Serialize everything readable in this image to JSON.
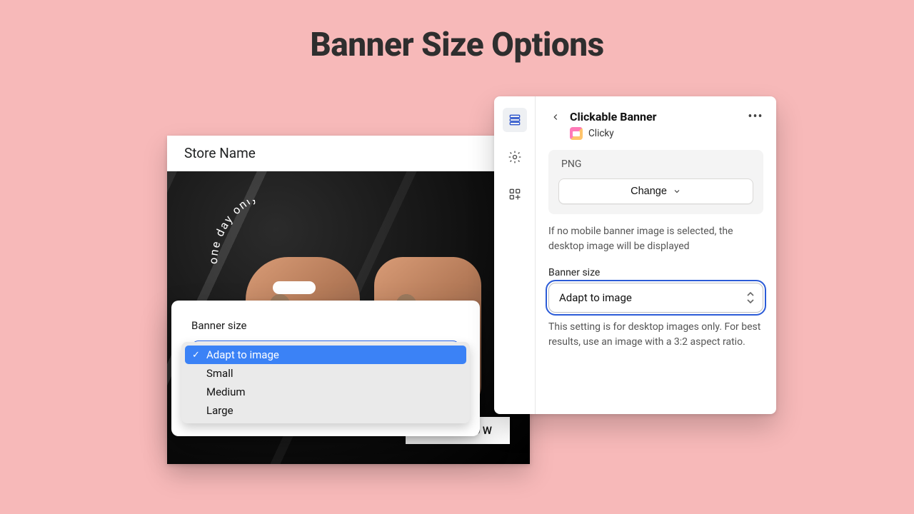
{
  "page_title": "Banner Size Options",
  "preview": {
    "store_name": "Store Name",
    "hero_curved_text": "one day only",
    "cta_label": "SHOP NOW"
  },
  "dropdown": {
    "label": "Banner size",
    "options": [
      "Adapt to image",
      "Small",
      "Medium",
      "Large"
    ],
    "selected_index": 0
  },
  "settings": {
    "title": "Clickable Banner",
    "app_name": "Clicky",
    "file_type": "PNG",
    "change_button": "Change",
    "mobile_note": "If no mobile banner image is selected, the desktop image will be displayed",
    "field_label": "Banner size",
    "select_value": "Adapt to image",
    "help_text": "This setting is for desktop images only. For best results, use an image with a 3:2 aspect ratio."
  }
}
